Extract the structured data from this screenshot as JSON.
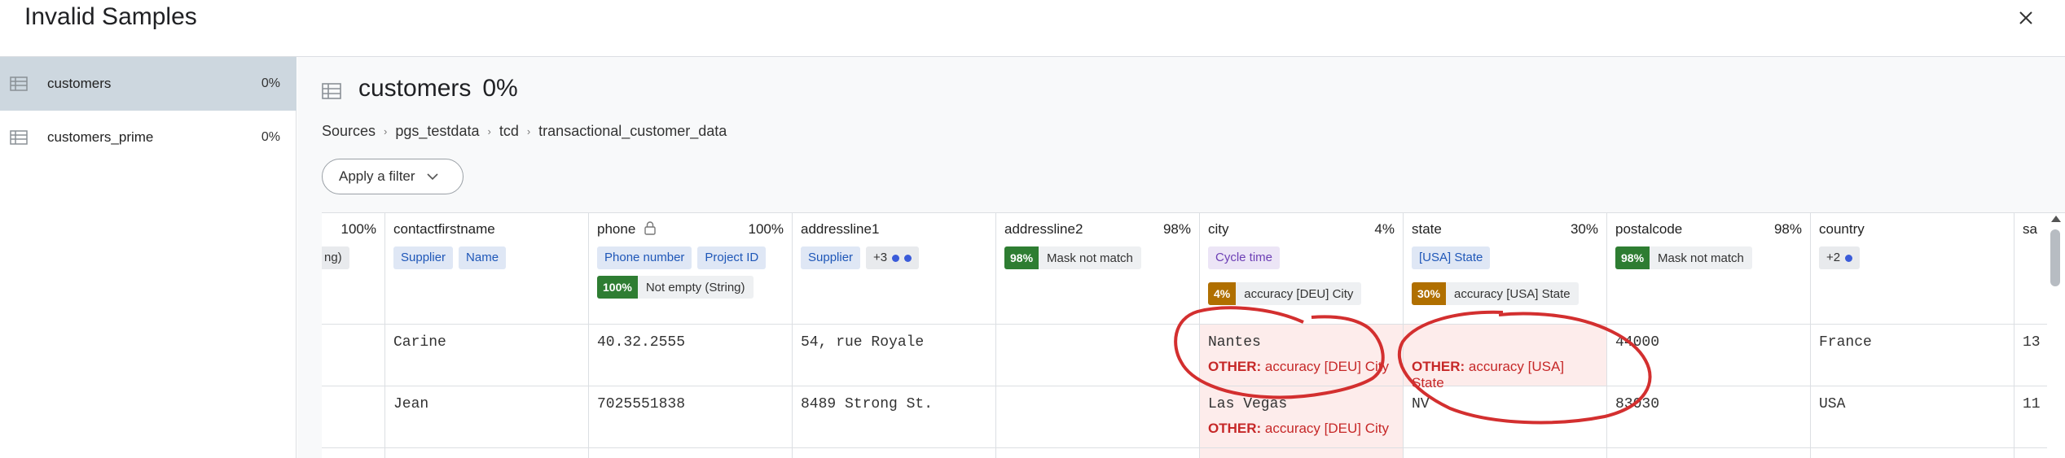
{
  "dialog": {
    "title": "Invalid Samples"
  },
  "sidebar": {
    "items": [
      {
        "label": "customers",
        "pct": "0%"
      },
      {
        "label": "customers_prime",
        "pct": "0%"
      }
    ]
  },
  "header": {
    "title": "customers",
    "pct": "0%"
  },
  "breadcrumb": [
    "Sources",
    "pgs_testdata",
    "tcd",
    "transactional_customer_data"
  ],
  "filter": {
    "label": "Apply a filter"
  },
  "columns": {
    "c0": {
      "pct": "100%",
      "tag": "ng)"
    },
    "contactfirstname": {
      "name": "contactfirstname",
      "tags": [
        "Supplier",
        "Name"
      ],
      "rows": [
        "Carine",
        "Jean"
      ]
    },
    "phone": {
      "name": "phone",
      "pct": "100%",
      "tags": [
        "Phone number",
        "Project ID"
      ],
      "rule": {
        "badge": "100%",
        "text": "Not empty (String)"
      },
      "rows": [
        "40.32.2555",
        "7025551838"
      ]
    },
    "addressline1": {
      "name": "addressline1",
      "tags": [
        "Supplier",
        "+3"
      ],
      "rows": [
        "54, rue Royale",
        "8489 Strong St."
      ]
    },
    "addressline2": {
      "name": "addressline2",
      "pct": "98%",
      "rule": {
        "badge": "98%",
        "text": "Mask not match"
      }
    },
    "city": {
      "name": "city",
      "pct": "4%",
      "tags": [
        "Cycle time"
      ],
      "rule": {
        "badge": "4%",
        "text": "accuracy [DEU] City"
      },
      "rows": [
        "Nantes",
        "Las Vegas"
      ],
      "error_prefix": "OTHER:",
      "error_text": "accuracy [DEU] City"
    },
    "state": {
      "name": "state",
      "pct": "30%",
      "tags": [
        "[USA] State"
      ],
      "rule": {
        "badge": "30%",
        "text": "accuracy [USA] State"
      },
      "rows": [
        "",
        "NV"
      ],
      "error_prefix": "OTHER:",
      "error_text": "accuracy [USA] State"
    },
    "postalcode": {
      "name": "postalcode",
      "pct": "98%",
      "rule": {
        "badge": "98%",
        "text": "Mask not match"
      },
      "rows": [
        "44000",
        "83030"
      ]
    },
    "country": {
      "name": "country",
      "tags": [
        "+2"
      ],
      "rows": [
        "France",
        "USA"
      ]
    },
    "sa": {
      "name": "sa",
      "rows": [
        "13",
        "11"
      ]
    }
  },
  "colors": {
    "accent_green": "#2e7d32",
    "accent_amber": "#b06f00",
    "error": "#c62828",
    "annotation": "#d32f2f"
  }
}
